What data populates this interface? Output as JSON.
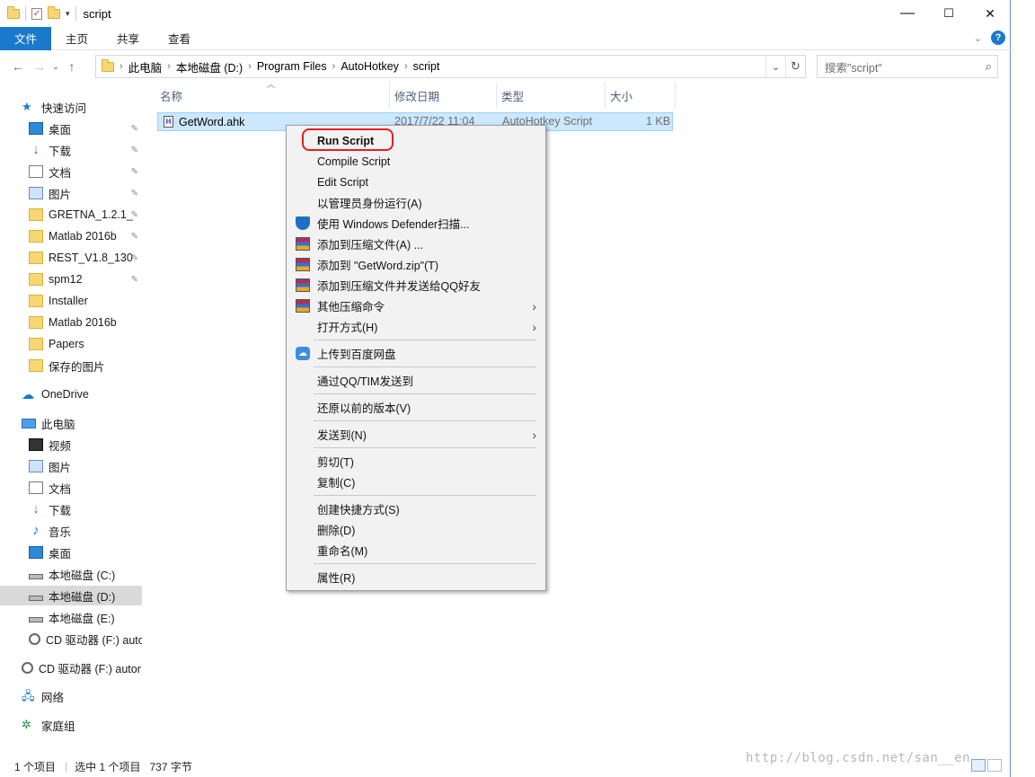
{
  "window": {
    "title": "script",
    "minimize": "—",
    "maximize": "☐",
    "close": "✕"
  },
  "ribbon": {
    "tabs": [
      "文件",
      "主页",
      "共享",
      "查看"
    ]
  },
  "address": {
    "crumbs": [
      "此电脑",
      "本地磁盘 (D:)",
      "Program Files",
      "AutoHotkey",
      "script"
    ],
    "search_placeholder": "搜索\"script\""
  },
  "nav": {
    "quick_access": "快速访问",
    "qa_items": [
      "桌面",
      "下载",
      "文档",
      "图片",
      "GRETNA_1.2.1_",
      "Matlab 2016b",
      "REST_V1.8_130",
      "spm12",
      "Installer",
      "Matlab 2016b",
      "Papers",
      "保存的图片"
    ],
    "onedrive": "OneDrive",
    "this_pc": "此电脑",
    "pc_items": [
      "视频",
      "图片",
      "文档",
      "下载",
      "音乐",
      "桌面",
      "本地磁盘 (C:)",
      "本地磁盘 (D:)",
      "本地磁盘 (E:)",
      "CD 驱动器 (F:) auto"
    ],
    "cd_drive": "CD 驱动器 (F:) autor",
    "network": "网络",
    "homegroup": "家庭组"
  },
  "columns": {
    "name": "名称",
    "modified": "修改日期",
    "type": "类型",
    "size": "大小"
  },
  "file": {
    "name": "GetWord.ahk",
    "modified": "2017/7/22 11:04",
    "type": "AutoHotkey Script",
    "size": "1 KB"
  },
  "context_menu": {
    "run": "Run Script",
    "compile": "Compile Script",
    "edit": "Edit Script",
    "run_admin": "以管理员身份运行(A)",
    "defender": "使用 Windows Defender扫描...",
    "add_archive": "添加到压缩文件(A) ...",
    "add_zip": "添加到 \"GetWord.zip\"(T)",
    "add_qq": "添加到压缩文件并发送给QQ好友",
    "other_compress": "其他压缩命令",
    "open_with": "打开方式(H)",
    "baidu": "上传到百度网盘",
    "qq_tim": "通过QQ/TIM发送到",
    "restore": "还原以前的版本(V)",
    "send_to": "发送到(N)",
    "cut": "剪切(T)",
    "copy": "复制(C)",
    "shortcut": "创建快捷方式(S)",
    "delete": "删除(D)",
    "rename": "重命名(M)",
    "properties": "属性(R)"
  },
  "status": {
    "items": "1 个项目",
    "selected": "选中 1 个项目",
    "bytes": "737 字节"
  },
  "watermark": "http://blog.csdn.net/san__en",
  "colors": {
    "accent": "#1979ca",
    "selection": "#cce8ff",
    "highlight": "#e0201f"
  }
}
